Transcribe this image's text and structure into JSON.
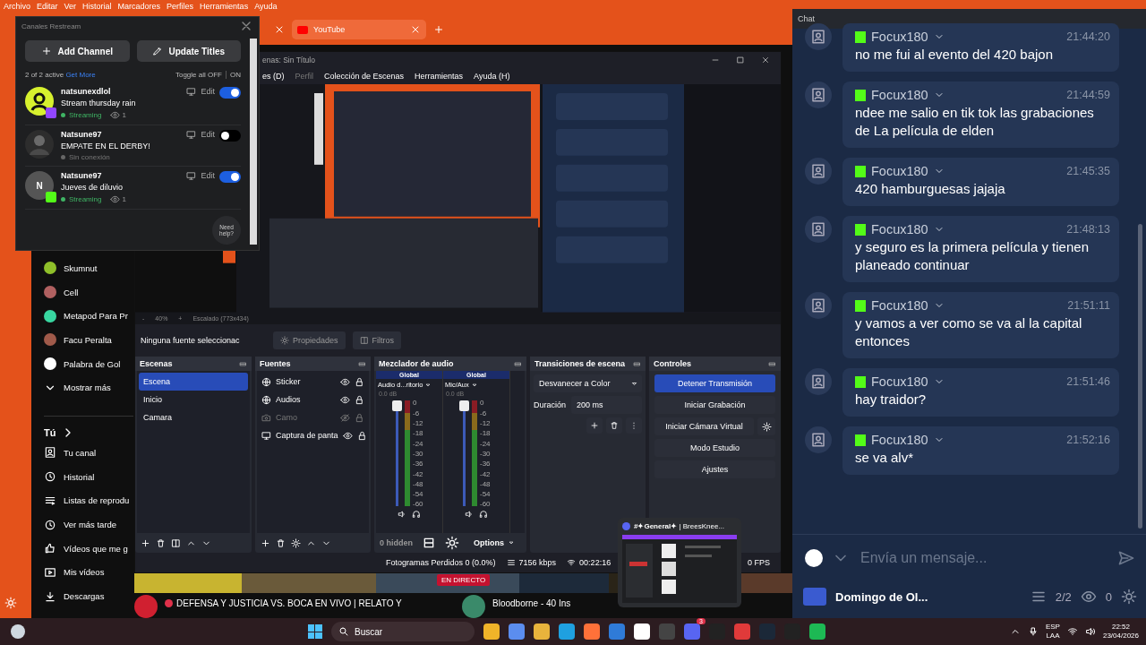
{
  "browser": {
    "menu": [
      "Archivo",
      "Editar",
      "Ver",
      "Historial",
      "Marcadores",
      "Perfiles",
      "Herramientas",
      "Ayuda"
    ],
    "tabs": [
      {
        "label": "YouTube",
        "selected": true
      }
    ],
    "sidebar": {
      "subscriptions": [
        {
          "name": "Skumnut"
        },
        {
          "name": "Cell"
        },
        {
          "name": "Metapod Para Pr"
        },
        {
          "name": "Facu Peralta"
        },
        {
          "name": "Palabra de Gol"
        }
      ],
      "show_more": "Mostrar más",
      "section": "Tú",
      "items": [
        {
          "label": "Tu canal",
          "kind": "channel"
        },
        {
          "label": "Historial",
          "kind": "history"
        },
        {
          "label": "Listas de reprodu",
          "kind": "playlists"
        },
        {
          "label": "Ver más tarde",
          "kind": "later"
        },
        {
          "label": "Vídeos que me g",
          "kind": "liked"
        },
        {
          "label": "Mis vídeos",
          "kind": "videos"
        },
        {
          "label": "Descargas",
          "kind": "downloads"
        }
      ]
    },
    "videos": [
      {
        "title": "DEFENSA Y JUSTICIA VS. BOCA EN VIVO | RELATO Y",
        "badge": "EN DIRECTO",
        "live": true
      },
      {
        "title": "Bloodborne - 40 Ins",
        "live": false
      }
    ]
  },
  "restream": {
    "title": "Canales Restream",
    "buttons": [
      {
        "label": "Add Channel",
        "kind": "add"
      },
      {
        "label": "Update Titles",
        "kind": "edit"
      }
    ],
    "summary": "2 of 2 active",
    "link": "Get More",
    "toggle_all": "Toggle all OFF",
    "toggle_on": "ON",
    "channels": [
      {
        "name": "natsunexdlol",
        "title": "Stream thursday rain",
        "status": "Streaming",
        "live": true,
        "viewers": "1",
        "on": true,
        "avatar": {
          "kind": "icon"
        },
        "platform": {
          "kind": "twitch"
        },
        "edit": "Edit"
      },
      {
        "name": "Natsune97",
        "title": "EMPATE EN EL DERBY!",
        "status": "Sin conexión",
        "live": false,
        "on": false,
        "edit": "Edit"
      },
      {
        "name": "Natsune97",
        "title": "Jueves de diluvio",
        "status": "Streaming",
        "live": true,
        "viewers": "1",
        "on": true,
        "avatar": {
          "kind": "initial",
          "initial": "N"
        },
        "platform": {
          "kind": "kick"
        },
        "edit": "Edit"
      }
    ],
    "help": "Need help?"
  },
  "obs": {
    "title": "enas: Sin Título",
    "menu": [
      {
        "label": "es (D)",
        "disabled": false
      },
      {
        "label": "Perfil",
        "disabled": true
      },
      {
        "label": "Colección de Escenas",
        "disabled": false
      },
      {
        "label": "Herramientas",
        "disabled": false
      },
      {
        "label": "Ayuda (H)",
        "disabled": false
      }
    ],
    "zoom": {
      "minus": "-",
      "value": "40%",
      "plus": "+",
      "scale": "Escalado (773x434)"
    },
    "source_bar": {
      "selection": "Ninguna fuente seleccionac",
      "buttons": [
        {
          "label": "Propiedades",
          "kind": "gear"
        },
        {
          "label": "Filtros",
          "kind": "filter"
        }
      ]
    },
    "scenes": {
      "title": "Escenas",
      "items": [
        {
          "label": "Escena",
          "selected": true
        },
        {
          "label": "Inicio",
          "selected": false
        },
        {
          "label": "Camara",
          "selected": false
        }
      ]
    },
    "sources": {
      "title": "Fuentes",
      "items": [
        {
          "label": "Sticker",
          "kind": "browser",
          "visible": true
        },
        {
          "label": "Audios",
          "kind": "browser",
          "visible": true
        },
        {
          "label": "Camo",
          "kind": "camera",
          "visible": false
        },
        {
          "label": "Captura de panta",
          "kind": "display",
          "visible": true
        }
      ]
    },
    "mixer": {
      "title": "Mezclador de audio",
      "channels": [
        {
          "tag": "Global",
          "name": "Audio d...ritorio",
          "reading": "0.0 dB",
          "level": 1,
          "scale": [
            "0",
            "-6",
            "-12",
            "-18",
            "-24",
            "-30",
            "-36",
            "-42",
            "-48",
            "-54",
            "-60"
          ]
        },
        {
          "tag": "Global",
          "name": "Mic/Aux",
          "reading": "0.0 dB",
          "level": 1,
          "scale": [
            "0",
            "-6",
            "-12",
            "-18",
            "-24",
            "-30",
            "-36",
            "-42",
            "-48",
            "-54",
            "-60"
          ]
        }
      ],
      "hidden": "0 hidden",
      "options": "Options"
    },
    "transitions": {
      "title": "Transiciones de escena",
      "selected": "Desvanecer a Color",
      "duration_label": "Duración",
      "duration": "200 ms"
    },
    "controls": {
      "title": "Controles",
      "buttons": [
        {
          "label": "Detener Transmisión",
          "active": true,
          "settings": false
        },
        {
          "label": "Iniciar Grabación",
          "active": false,
          "settings": false
        },
        {
          "label": "Iniciar Cámara Virtual",
          "active": false,
          "settings": true
        },
        {
          "label": "Modo Estudio",
          "active": false,
          "settings": false
        },
        {
          "label": "Ajustes",
          "active": false,
          "settings": false
        }
      ]
    },
    "status": {
      "dropped": "Fotogramas Perdidos 0 (0.0%)",
      "bitrate": "7156 kbps",
      "time": "00:22:16",
      "fps": "0 FPS"
    }
  },
  "chat": {
    "title": "Chat",
    "messages": [
      {
        "user": "Focux180",
        "time": "21:44:20",
        "text": "no me fui al evento del 420 bajon"
      },
      {
        "user": "Focux180",
        "time": "21:44:59",
        "text": "ndee me salio en tik tok las grabaciones de La película de elden"
      },
      {
        "user": "Focux180",
        "time": "21:45:35",
        "text": "420 hamburguesas jajaja"
      },
      {
        "user": "Focux180",
        "time": "21:48:13",
        "text": "y seguro es la primera película y tienen planeado continuar"
      },
      {
        "user": "Focux180",
        "time": "21:51:11",
        "text": "y vamos a ver como se va al la capital entonces"
      },
      {
        "user": "Focux180",
        "time": "21:51:46",
        "text": "hay traidor?"
      },
      {
        "user": "Focux180",
        "time": "21:52:16",
        "text": "se va alv*"
      }
    ],
    "input": {
      "placeholder": "Envía un mensaje..."
    },
    "footer": {
      "channel": "Domingo de Ol...",
      "count": "2/2",
      "viewers": "0"
    }
  },
  "discord_preview": {
    "title": "**#✦General✦** | BreesKnee..."
  },
  "taskbar": {
    "search": "Buscar",
    "badge": "3",
    "language": "ESP",
    "layout": "LAA",
    "time": "22:52",
    "date": "23/04/2026"
  }
}
